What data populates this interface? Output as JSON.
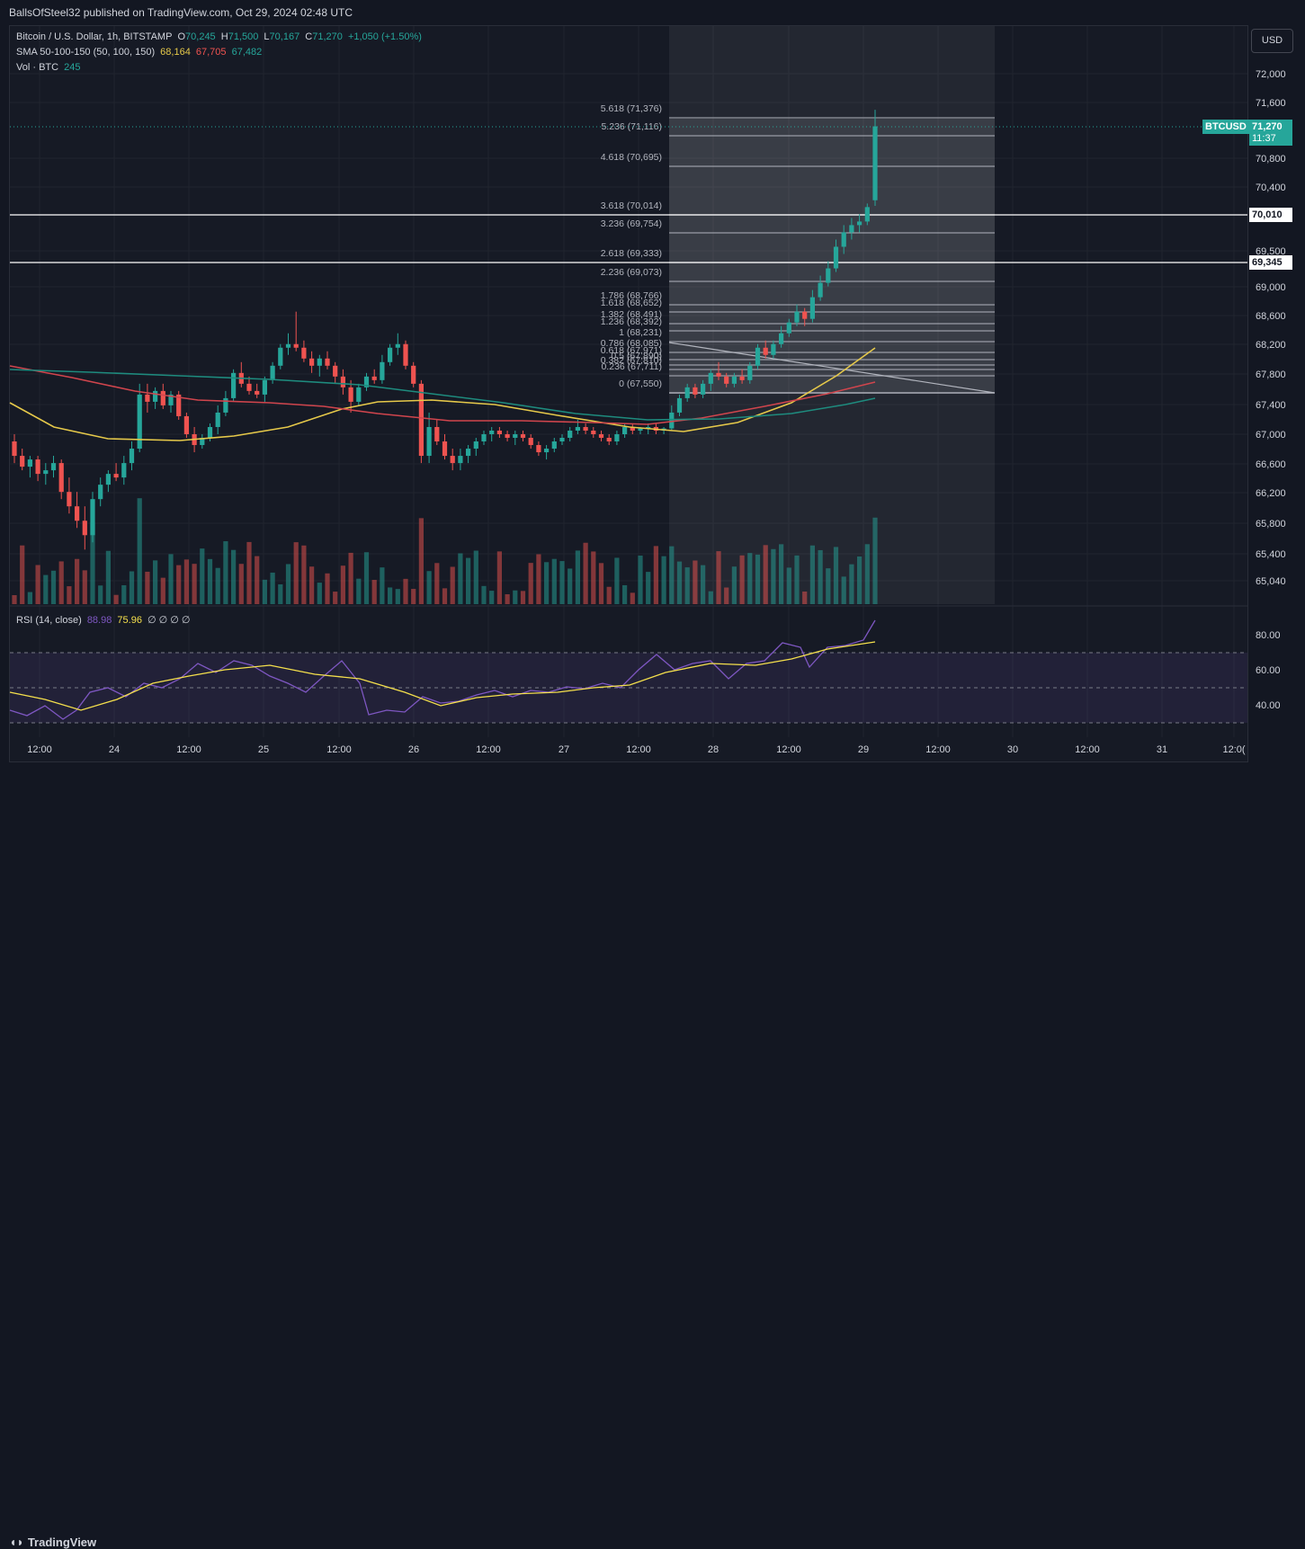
{
  "header": {
    "published": "BallsOfSteel32 published on TradingView.com, Oct 29, 2024 02:48 UTC"
  },
  "legend": {
    "symbol": "Bitcoin / U.S. Dollar, 1h, BITSTAMP",
    "o_label": "O",
    "o_value": "70,245",
    "h_label": "H",
    "h_value": "71,500",
    "l_label": "L",
    "l_value": "70,167",
    "c_label": "C",
    "c_value": "71,270",
    "change": "+1,050 (+1.50%)",
    "sma_label": "SMA 50-100-150 (50, 100, 150)",
    "sma50": "68,164",
    "sma100": "67,705",
    "sma150": "67,482",
    "vol_label": "Vol · BTC",
    "vol_value": "245",
    "rsi_label": "RSI (14, close)",
    "rsi_value": "88.98",
    "rsi_ma": "75.96",
    "rsi_extra": "∅ ∅ ∅ ∅"
  },
  "toolbar": {
    "currency": "USD"
  },
  "footer": {
    "logo_text": "TradingView"
  },
  "price_tags": {
    "symbol": "BTCUSD",
    "last": "71,270",
    "countdown": "11:37",
    "line1": "70,010",
    "line2": "69,345"
  },
  "colors": {
    "up": "#26a69a",
    "down": "#ef5350",
    "sma50": "#e6c94a",
    "sma100": "#d0454d",
    "sma150": "#1e8b7e",
    "rsi": "#7e57c2",
    "rsi_ma": "#f5e04c"
  },
  "chart_data": {
    "type": "candlestick",
    "timeframe": "1h",
    "y_axis_ticks": [
      "72,000",
      "71,600",
      "70,800",
      "70,400",
      "69,500",
      "69,000",
      "68,600",
      "68,200",
      "67,800",
      "67,400",
      "67,000",
      "66,600",
      "66,200",
      "65,800",
      "65,400",
      "65,040"
    ],
    "x_axis_ticks": [
      "12:00",
      "24",
      "12:00",
      "25",
      "12:00",
      "26",
      "12:00",
      "27",
      "12:00",
      "28",
      "12:00",
      "29",
      "12:00",
      "30",
      "12:00",
      "31",
      "12:0("
    ],
    "rsi_axis_ticks": [
      "80.00",
      "60.00",
      "40.00"
    ],
    "fib_levels": [
      {
        "ratio": "5.618",
        "price": "71,376"
      },
      {
        "ratio": "5.236",
        "price": "71,116"
      },
      {
        "ratio": "4.618",
        "price": "70,695"
      },
      {
        "ratio": "3.618",
        "price": "70,014"
      },
      {
        "ratio": "3.236",
        "price": "69,754"
      },
      {
        "ratio": "2.618",
        "price": "69,333"
      },
      {
        "ratio": "2.236",
        "price": "69,073"
      },
      {
        "ratio": "1.786",
        "price": "68,766"
      },
      {
        "ratio": "1.618",
        "price": "68,652"
      },
      {
        "ratio": "1.382",
        "price": "68,491"
      },
      {
        "ratio": "1.236",
        "price": "68,392"
      },
      {
        "ratio": "1",
        "price": "68,231"
      },
      {
        "ratio": "0.786",
        "price": "68,085"
      },
      {
        "ratio": "0.618",
        "price": "67,971"
      },
      {
        "ratio": "0.5",
        "price": "67,890"
      },
      {
        "ratio": "0.382",
        "price": "67,810"
      },
      {
        "ratio": "0.236",
        "price": "67,711"
      },
      {
        "ratio": "0",
        "price": "67,550"
      }
    ],
    "horizontal_lines": [
      70010,
      69345
    ],
    "candles_ohlc": [
      [
        66900,
        67000,
        66600,
        66700
      ],
      [
        66700,
        66800,
        66500,
        66550
      ],
      [
        66550,
        66700,
        66400,
        66650
      ],
      [
        66650,
        66700,
        66350,
        66450
      ],
      [
        66450,
        66600,
        66300,
        66500
      ],
      [
        66500,
        66700,
        66400,
        66600
      ],
      [
        66600,
        66650,
        66100,
        66200
      ],
      [
        66200,
        66400,
        65900,
        66000
      ],
      [
        66000,
        66200,
        65700,
        65800
      ],
      [
        65800,
        66000,
        65400,
        65600
      ],
      [
        65600,
        66200,
        65500,
        66100
      ],
      [
        66100,
        66400,
        66000,
        66300
      ],
      [
        66300,
        66500,
        66200,
        66450
      ],
      [
        66450,
        66600,
        66350,
        66400
      ],
      [
        66400,
        66700,
        66300,
        66600
      ],
      [
        66600,
        66900,
        66500,
        66800
      ],
      [
        66800,
        67700,
        66750,
        67550
      ],
      [
        67550,
        67700,
        67300,
        67450
      ],
      [
        67450,
        67650,
        67350,
        67600
      ],
      [
        67600,
        67700,
        67350,
        67400
      ],
      [
        67400,
        67600,
        67300,
        67550
      ],
      [
        67550,
        67600,
        67200,
        67250
      ],
      [
        67250,
        67300,
        66950,
        67000
      ],
      [
        67000,
        67100,
        66750,
        66850
      ],
      [
        66850,
        67000,
        66800,
        66950
      ],
      [
        66950,
        67150,
        66900,
        67100
      ],
      [
        67100,
        67400,
        67000,
        67300
      ],
      [
        67300,
        67600,
        67250,
        67500
      ],
      [
        67500,
        67900,
        67450,
        67850
      ],
      [
        67850,
        68000,
        67650,
        67700
      ],
      [
        67700,
        67800,
        67550,
        67600
      ],
      [
        67600,
        67700,
        67500,
        67550
      ],
      [
        67550,
        67800,
        67450,
        67750
      ],
      [
        67750,
        68000,
        67700,
        67950
      ],
      [
        67950,
        68250,
        67900,
        68200
      ],
      [
        68200,
        68400,
        68100,
        68250
      ],
      [
        68250,
        68700,
        68150,
        68200
      ],
      [
        68200,
        68300,
        68000,
        68050
      ],
      [
        68050,
        68150,
        67850,
        67950
      ],
      [
        67950,
        68100,
        67800,
        68050
      ],
      [
        68050,
        68150,
        67900,
        67950
      ],
      [
        67950,
        68000,
        67700,
        67800
      ],
      [
        67800,
        67900,
        67550,
        67650
      ],
      [
        67650,
        67750,
        67300,
        67450
      ],
      [
        67450,
        67700,
        67400,
        67650
      ],
      [
        67650,
        67850,
        67600,
        67800
      ],
      [
        67800,
        67900,
        67700,
        67750
      ],
      [
        67750,
        68100,
        67700,
        68000
      ],
      [
        68000,
        68250,
        67950,
        68200
      ],
      [
        68200,
        68400,
        68100,
        68250
      ],
      [
        68250,
        68300,
        67900,
        67950
      ],
      [
        67950,
        68000,
        67650,
        67700
      ],
      [
        67700,
        67750,
        66600,
        66700
      ],
      [
        66700,
        67300,
        66600,
        67100
      ],
      [
        67100,
        67200,
        66850,
        66900
      ],
      [
        66900,
        67000,
        66650,
        66700
      ],
      [
        66700,
        66800,
        66500,
        66600
      ],
      [
        66600,
        66800,
        66500,
        66700
      ],
      [
        66700,
        66850,
        66600,
        66800
      ],
      [
        66800,
        66950,
        66700,
        66900
      ],
      [
        66900,
        67050,
        66850,
        67000
      ],
      [
        67000,
        67100,
        66900,
        67050
      ],
      [
        67050,
        67100,
        66950,
        67000
      ],
      [
        67000,
        67050,
        66900,
        66950
      ],
      [
        66950,
        67050,
        66850,
        67000
      ],
      [
        67000,
        67050,
        66900,
        66950
      ],
      [
        66950,
        67000,
        66800,
        66850
      ],
      [
        66850,
        66900,
        66700,
        66750
      ],
      [
        66750,
        66850,
        66650,
        66800
      ],
      [
        66800,
        66950,
        66750,
        66900
      ],
      [
        66900,
        67000,
        66850,
        66950
      ],
      [
        66950,
        67100,
        66900,
        67050
      ],
      [
        67050,
        67200,
        67000,
        67100
      ],
      [
        67100,
        67150,
        67000,
        67050
      ],
      [
        67050,
        67100,
        66950,
        67000
      ],
      [
        67000,
        67050,
        66900,
        66950
      ],
      [
        66950,
        67000,
        66850,
        66900
      ],
      [
        66900,
        67050,
        66850,
        67000
      ],
      [
        67000,
        67150,
        66950,
        67100
      ],
      [
        67100,
        67150,
        67000,
        67050
      ],
      [
        67050,
        67100,
        67000,
        67080
      ],
      [
        67080,
        67150,
        67000,
        67100
      ],
      [
        67100,
        67150,
        67000,
        67050
      ],
      [
        67050,
        67100,
        67000,
        67080
      ],
      [
        67080,
        67400,
        67050,
        67300
      ],
      [
        67300,
        67550,
        67250,
        67500
      ],
      [
        67500,
        67700,
        67450,
        67650
      ],
      [
        67650,
        67700,
        67500,
        67550
      ],
      [
        67550,
        67750,
        67500,
        67700
      ],
      [
        67700,
        67900,
        67600,
        67850
      ],
      [
        67850,
        68000,
        67750,
        67800
      ],
      [
        67800,
        67850,
        67650,
        67700
      ],
      [
        67700,
        67850,
        67650,
        67800
      ],
      [
        67800,
        67900,
        67700,
        67750
      ],
      [
        67750,
        68000,
        67700,
        67950
      ],
      [
        67950,
        68250,
        67900,
        68200
      ],
      [
        68200,
        68300,
        68050,
        68100
      ],
      [
        68100,
        68300,
        68050,
        68250
      ],
      [
        68250,
        68500,
        68200,
        68400
      ],
      [
        68400,
        68600,
        68350,
        68550
      ],
      [
        68550,
        68800,
        68500,
        68700
      ],
      [
        68700,
        68750,
        68500,
        68600
      ],
      [
        68600,
        69000,
        68550,
        68900
      ],
      [
        68900,
        69200,
        68850,
        69100
      ],
      [
        69100,
        69400,
        69050,
        69300
      ],
      [
        69300,
        69700,
        69250,
        69600
      ],
      [
        69600,
        69900,
        69500,
        69800
      ],
      [
        69800,
        70000,
        69700,
        69900
      ],
      [
        69900,
        70050,
        69800,
        69950
      ],
      [
        69950,
        70200,
        69900,
        70150
      ],
      [
        70245,
        71500,
        70167,
        71270
      ]
    ],
    "volume": [],
    "sma_series": [
      {
        "name": "SMA 50",
        "last": 68164
      },
      {
        "name": "SMA 100",
        "last": 67705
      },
      {
        "name": "SMA 150",
        "last": 67482
      }
    ],
    "rsi_last": 88.98,
    "rsi_ma_last": 75.96
  }
}
